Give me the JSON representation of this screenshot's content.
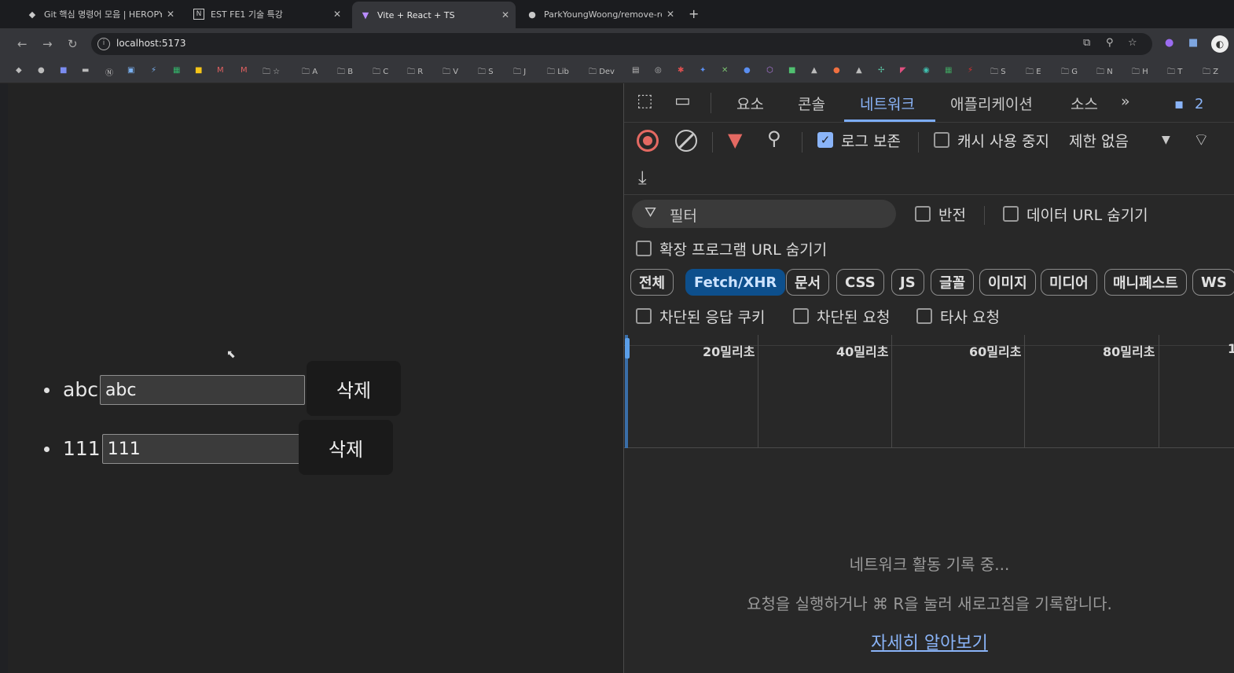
{
  "browser": {
    "tabs": [
      {
        "title": "Git 핵심 명령어 모음 | HEROPY",
        "icon": "heropy-icon"
      },
      {
        "title": "EST FE1 기술 특강",
        "icon": "notion-icon"
      },
      {
        "title": "Vite + React + TS",
        "icon": "vite-icon"
      },
      {
        "title": "ParkYoungWoong/remove-re",
        "icon": "github-icon"
      }
    ],
    "new_tab": "+",
    "url": "localhost:5173",
    "bookmark_folders": [
      "A",
      "B",
      "C",
      "R",
      "V",
      "S",
      "J",
      "Lib",
      "Dev",
      "S",
      "E",
      "G",
      "N",
      "H",
      "T",
      "Z"
    ]
  },
  "app": {
    "todos": [
      {
        "text": "abc",
        "value": "abc",
        "delete_label": "삭제"
      },
      {
        "text": "111",
        "value": "111",
        "delete_label": "삭제"
      }
    ]
  },
  "devtools": {
    "tabs": [
      "요소",
      "콘솔",
      "네트워크",
      "애플리케이션",
      "소스"
    ],
    "active_tab": "네트워크",
    "more": "»",
    "issues_count": "2",
    "toolbar": {
      "preserve_log": "로그 보존",
      "disable_cache": "캐시 사용 중지",
      "throttling": "제한 없음"
    },
    "filter": {
      "placeholder": "필터",
      "invert": "반전",
      "hide_data_urls": "데이터 URL 숨기기",
      "hide_extension_urls": "확장 프로그램 URL 숨기기"
    },
    "type_filters": [
      "전체",
      "Fetch/XHR",
      "문서",
      "CSS",
      "JS",
      "글꼴",
      "이미지",
      "미디어",
      "매니페스트",
      "WS"
    ],
    "active_type_filter": "Fetch/XHR",
    "extra_filters": [
      "차단된 응답 쿠키",
      "차단된 요청",
      "타사 요청"
    ],
    "timeline_labels": [
      "20밀리초",
      "40밀리초",
      "60밀리초",
      "80밀리초",
      "1"
    ],
    "empty": {
      "title": "네트워크 활동 기록 중...",
      "description": "요청을 실행하거나 ⌘ R을 눌러 새로고침을 기록합니다.",
      "learn_more": "자세히 알아보기"
    }
  },
  "colors": {
    "accent": "#8ab4f8",
    "record": "#e46962",
    "active_chip": "#0d4f8c"
  }
}
